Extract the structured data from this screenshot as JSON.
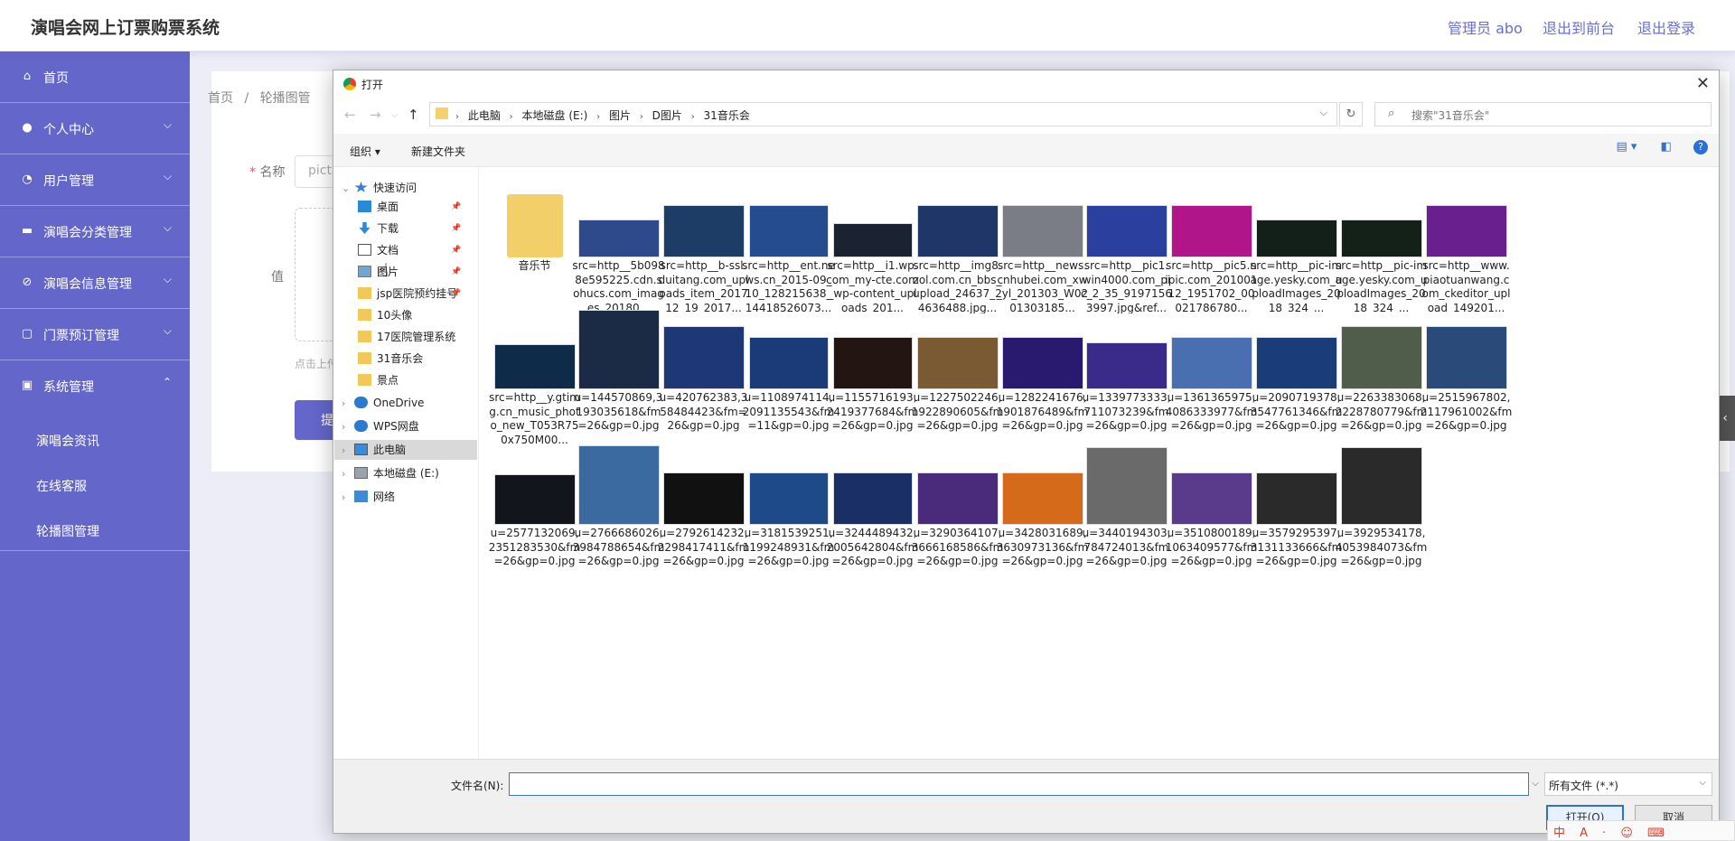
{
  "header": {
    "app_title": "演唱会网上订票购票系统",
    "admin_label": "管理员 abo",
    "to_front_label": "退出到前台",
    "logout_label": "退出登录"
  },
  "sidebar": {
    "items": [
      {
        "label": "首页",
        "icon": "home-icon",
        "expandable": false
      },
      {
        "label": "个人中心",
        "icon": "user-icon",
        "expandable": true
      },
      {
        "label": "用户管理",
        "icon": "clock-icon",
        "expandable": true
      },
      {
        "label": "演唱会分类管理",
        "icon": "briefcase-icon",
        "expandable": true
      },
      {
        "label": "演唱会信息管理",
        "icon": "disabled-icon",
        "expandable": true
      },
      {
        "label": "门票预订管理",
        "icon": "frame-icon",
        "expandable": true
      },
      {
        "label": "系统管理",
        "icon": "calendar-icon",
        "expandable": true,
        "expanded": true
      }
    ],
    "sub_items": [
      {
        "label": "演唱会资讯"
      },
      {
        "label": "在线客服"
      },
      {
        "label": "轮播图管理"
      }
    ]
  },
  "main": {
    "breadcrumb_home": "首页",
    "breadcrumb_sep": "/",
    "breadcrumb_current": "轮播图管",
    "name_label": "名称",
    "name_value": "pictu",
    "value_label": "值",
    "upload_hint": "点击上传",
    "submit_label": "提"
  },
  "dialog": {
    "title": "打开",
    "close": "✕",
    "path": [
      "此电脑",
      "本地磁盘 (E:)",
      "图片",
      "D图片",
      "31音乐会"
    ],
    "search_placeholder": "搜索\"31音乐会\"",
    "toolbar": {
      "organize": "组织 ▾",
      "new_folder": "新建文件夹"
    },
    "nav": [
      {
        "label": "快速访问",
        "icon": "star-icon",
        "level": 0,
        "chevron": "⌄"
      },
      {
        "label": "桌面",
        "icon": "desktop-icon",
        "level": 1,
        "pinned": true
      },
      {
        "label": "下载",
        "icon": "download-icon",
        "level": 1,
        "pinned": true
      },
      {
        "label": "文档",
        "icon": "document-icon",
        "level": 1,
        "pinned": true
      },
      {
        "label": "图片",
        "icon": "pictures-icon",
        "level": 1,
        "pinned": true
      },
      {
        "label": "jsp医院预约挂号",
        "icon": "folder-icon",
        "level": 1,
        "pinned": true
      },
      {
        "label": "10头像",
        "icon": "folder-icon",
        "level": 1
      },
      {
        "label": "17医院管理系统",
        "icon": "folder-icon",
        "level": 1
      },
      {
        "label": "31音乐会",
        "icon": "folder-icon",
        "level": 1
      },
      {
        "label": "景点",
        "icon": "folder-icon",
        "level": 1
      },
      {
        "label": "OneDrive",
        "icon": "cloud-icon",
        "level": 0,
        "chevron": "›"
      },
      {
        "label": "WPS网盘",
        "icon": "cloud-icon",
        "level": 0,
        "chevron": "›"
      },
      {
        "label": "此电脑",
        "icon": "computer-icon",
        "level": 0,
        "chevron": "›",
        "selected": true
      },
      {
        "label": "本地磁盘 (E:)",
        "icon": "drive-icon",
        "level": 0,
        "chevron": "›"
      },
      {
        "label": "网络",
        "icon": "network-icon",
        "level": 0,
        "chevron": "›"
      }
    ],
    "files": [
      {
        "caption": "音乐节",
        "kind": "folder"
      },
      {
        "caption": "src=http__5b0988e595225.cdn.sohucs.com_images_20180...",
        "color": "#2f4a8a"
      },
      {
        "caption": "src=http__b-ssl.duitang.com_uploads_item_201712_19_2017...",
        "color": "#1d3d66"
      },
      {
        "caption": "src=http__ent.news.cn_2015-09_10_128215638_14418526073...",
        "color": "#254c8f"
      },
      {
        "caption": "src=http__i1.wp.com_my-cte.com_wp-content_uploads_201...",
        "color": "#1b2232"
      },
      {
        "caption": "src=http__img8.zol.com.cn_bbs_upload_24637_24636488.jpg...",
        "color": "#1f3768"
      },
      {
        "caption": "src=http__news.cnhubei.com_xw_yl_201303_W0201303185...",
        "color": "#7a7d85"
      },
      {
        "caption": "src=http__pic1.win4000.com_pic_2_35_91971563997.jpg&ref...",
        "color": "#2b3f9e"
      },
      {
        "caption": "src=http__pic5.nipic.com_20100112_1951702_00021786780...",
        "color": "#b0158a"
      },
      {
        "caption": "src=http__pic-image.yesky.com_uploadImages_2018_324_...",
        "color": "#132019"
      },
      {
        "caption": "src=http__pic-image.yesky.com_uploadImages_2018_324_...",
        "color": "#142118"
      },
      {
        "caption": "src=http__www.piaotuanwang.com_ckeditor_upload_149201...",
        "color": "#6a1f8f"
      },
      {
        "caption": "src=http__y.gtimg.cn_music_photo_new_T053R750x750M00...",
        "color": "#0e2b4a"
      },
      {
        "caption": "u=144570869,3193035618&fm=26&gp=0.jpg",
        "color": "#1b2b45"
      },
      {
        "caption": "u=420762383,358484423&fm=26&gp=0.jpg",
        "color": "#1e3777"
      },
      {
        "caption": "u=1108974114,2091135543&fm=11&gp=0.jpg",
        "color": "#1a3a78"
      },
      {
        "caption": "u=1155716193,2419377684&fm=26&gp=0.jpg",
        "color": "#221512"
      },
      {
        "caption": "u=1227502246,1922890605&fm=26&gp=0.jpg",
        "color": "#7a5a33"
      },
      {
        "caption": "u=1282241676,1901876489&fm=26&gp=0.jpg",
        "color": "#2a1a6f"
      },
      {
        "caption": "u=1339773333,711073239&fm=26&gp=0.jpg",
        "color": "#3a2a8a"
      },
      {
        "caption": "u=1361365975,4086333977&fm=26&gp=0.jpg",
        "color": "#4a6fb0"
      },
      {
        "caption": "u=2090719378,3547761346&fm=26&gp=0.jpg",
        "color": "#1a3d7a"
      },
      {
        "caption": "u=2263383068,2228780779&fm=26&gp=0.jpg",
        "color": "#4f5d4a"
      },
      {
        "caption": "u=2515967802,2117961002&fm=26&gp=0.jpg",
        "color": "#2a4a7a"
      },
      {
        "caption": "u=2577132069,2351283530&fm=26&gp=0.jpg",
        "color": "#12151c"
      },
      {
        "caption": "u=2766686026,3984788654&fm=26&gp=0.jpg",
        "color": "#3a6aa0"
      },
      {
        "caption": "u=2792614232,2298417411&fm=26&gp=0.jpg",
        "color": "#111111"
      },
      {
        "caption": "u=3181539251,1199248931&fm=26&gp=0.jpg",
        "color": "#1f4a8a"
      },
      {
        "caption": "u=3244489432,2005642804&fm=26&gp=0.jpg",
        "color": "#1a2f66"
      },
      {
        "caption": "u=3290364107,3666168586&fm=26&gp=0.jpg",
        "color": "#4a2a7a"
      },
      {
        "caption": "u=3428031689,3630973136&fm=26&gp=0.jpg",
        "color": "#d46a1a"
      },
      {
        "caption": "u=3440194303,784724013&fm=26&gp=0.jpg",
        "color": "#6a6a6a"
      },
      {
        "caption": "u=3510800189,1063409577&fm=26&gp=0.jpg",
        "color": "#5a3a8a"
      },
      {
        "caption": "u=3579295397,3131133666&fm=26&gp=0.jpg",
        "color": "#2a2a2a"
      },
      {
        "caption": "u=3929534178,4053984073&fm=26&gp=0.jpg",
        "color": "#2a2a2a"
      }
    ],
    "bottom": {
      "filename_label": "文件名(N):",
      "filename_value": "",
      "filetype": "所有文件 (*.*)",
      "open_label": "打开(O)",
      "cancel_label": "取消"
    }
  },
  "ime_bar": "中 A · ☺ ⌨"
}
